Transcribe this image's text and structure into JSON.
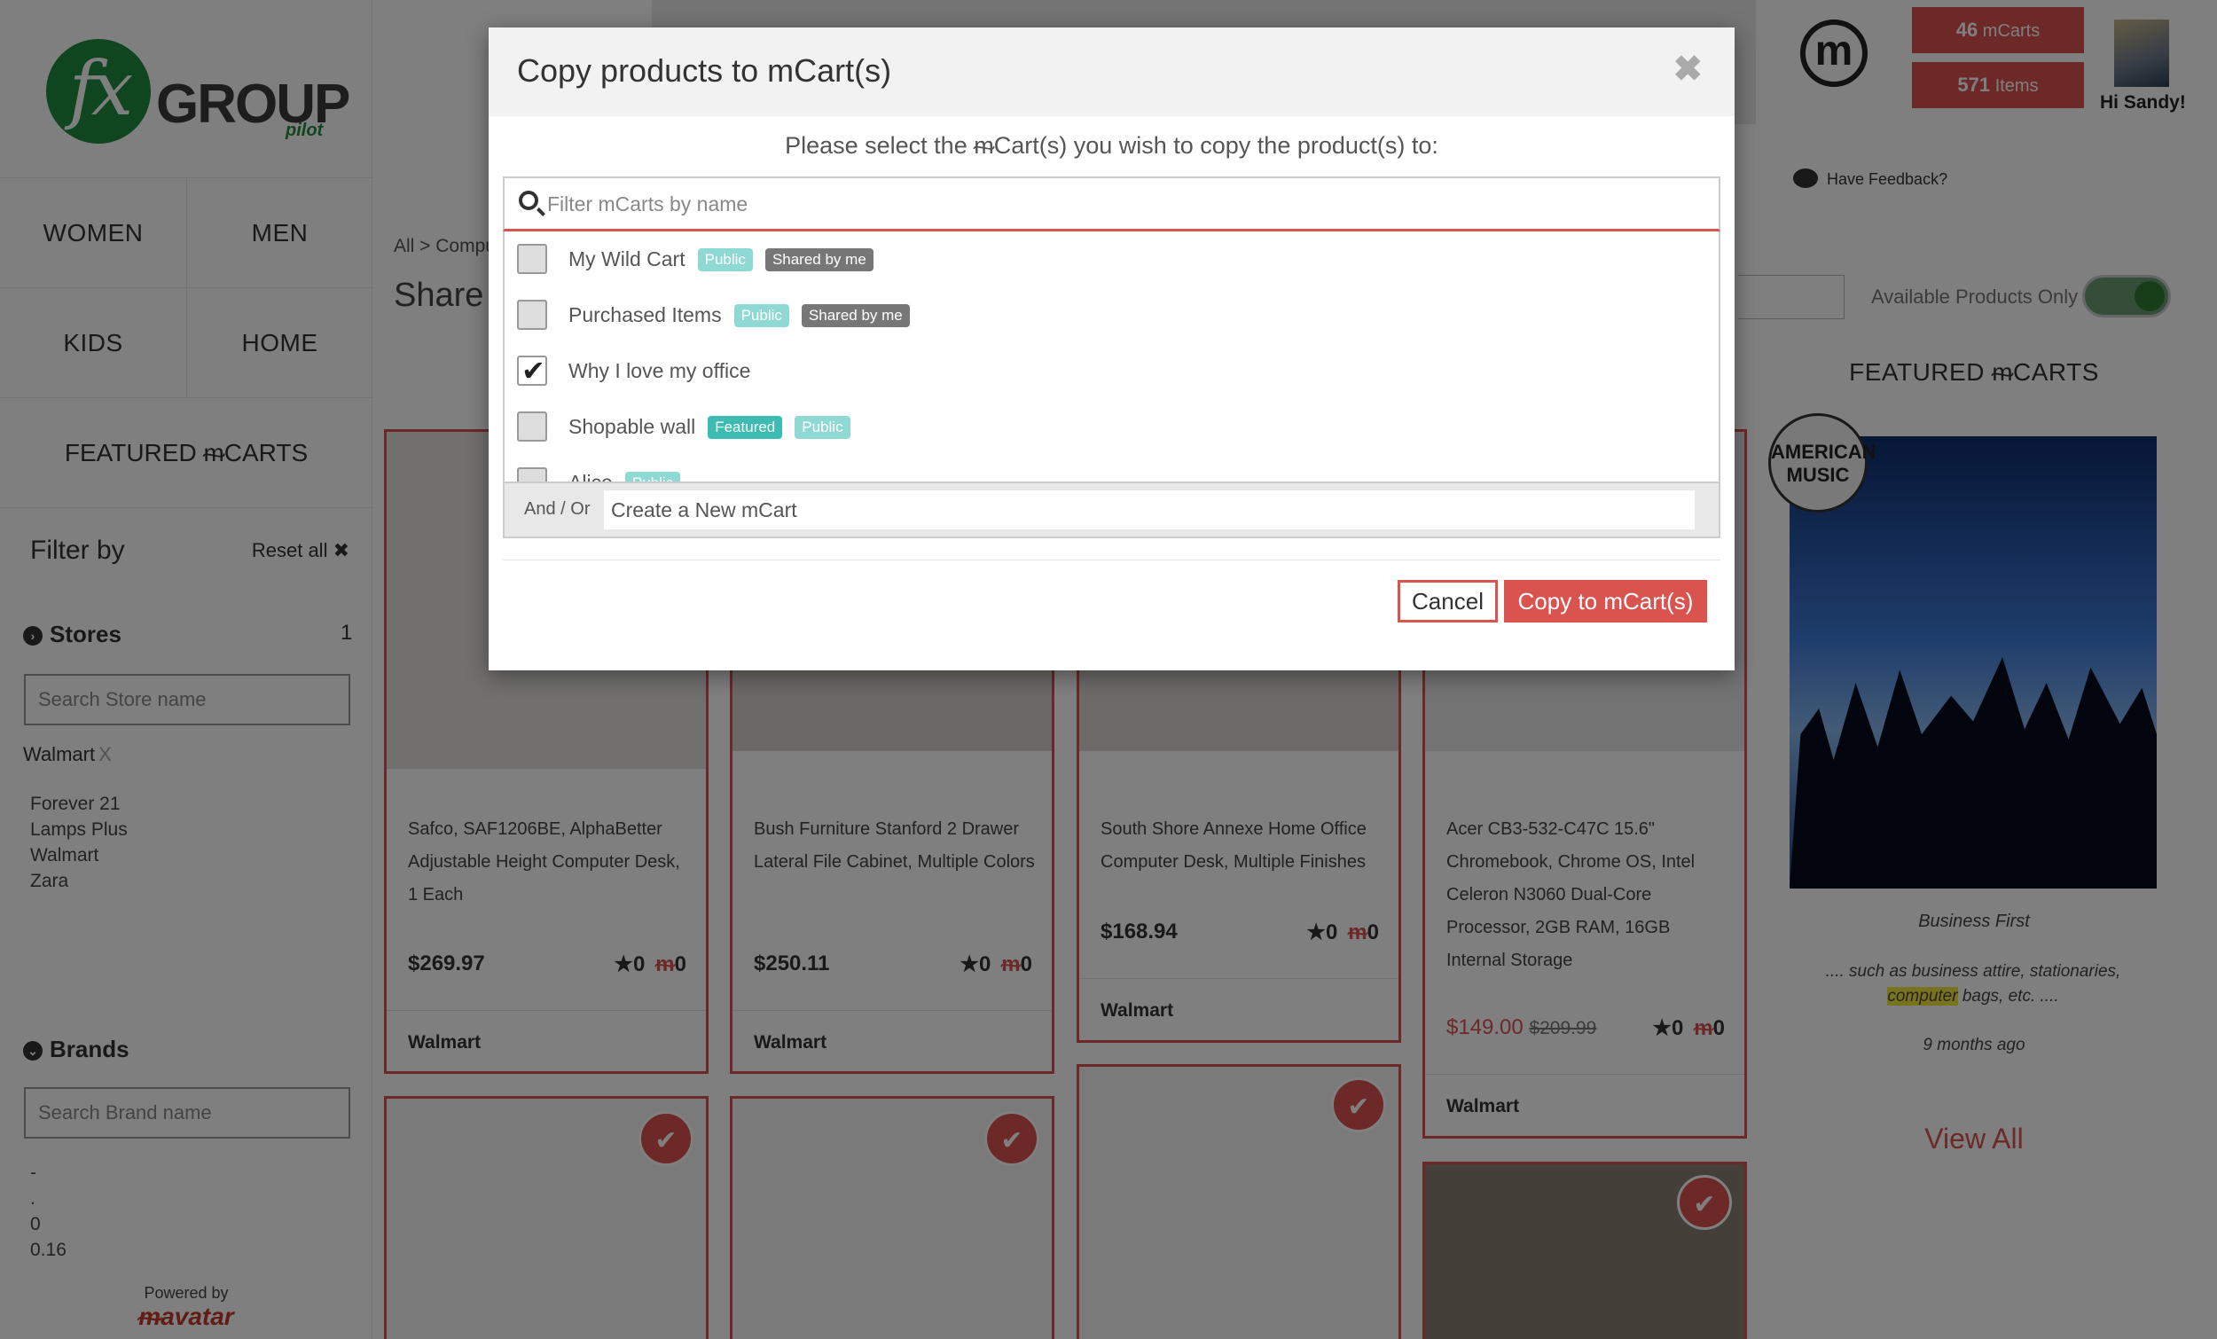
{
  "brand": {
    "logo_main": "fx",
    "logo_word": "GROUP",
    "logo_sub": "pilot"
  },
  "nav": {
    "women": "WOMEN",
    "men": "MEN",
    "kids": "KIDS",
    "home": "HOME",
    "featured": "FEATURED ᵯCARTS"
  },
  "filters": {
    "heading": "Filter by",
    "reset_label": "Reset all ✖",
    "stores_heading": "Stores",
    "stores_count": "1",
    "store_search_placeholder": "Search Store name",
    "store_selected": "Walmart",
    "store_selected_remove": "X",
    "store_options": [
      "Forever 21",
      "Lamps Plus",
      "Walmart",
      "Zara"
    ],
    "brands_heading": "Brands",
    "brand_search_placeholder": "Search Brand name",
    "brand_options": [
      "-",
      ".",
      "0",
      "0.16"
    ]
  },
  "powered_by": {
    "label": "Powered by",
    "brand": "ᵯavatar"
  },
  "header": {
    "mcarts_count": "46",
    "mcarts_label": "mCarts",
    "items_count": "571",
    "items_label": "Items",
    "greeting": "Hi Sandy!",
    "feedback": "Have Feedback?"
  },
  "main": {
    "breadcrumb": "All > Compu",
    "title": "Share",
    "available_only": "Available Products Only"
  },
  "products": [
    {
      "title": "Safco, SAF1206BE, AlphaBetter Adjustable Height Computer Desk, 1 Each",
      "price": "$269.97",
      "stars": "0",
      "mcarts": "0",
      "store": "Walmart"
    },
    {
      "title": "Bush Furniture Stanford 2 Drawer Lateral File Cabinet, Multiple Colors",
      "price": "$250.11",
      "stars": "0",
      "mcarts": "0",
      "store": "Walmart"
    },
    {
      "title": "South Shore Annexe Home Office Computer Desk, Multiple Finishes",
      "price": "$168.94",
      "stars": "0",
      "mcarts": "0",
      "store": "Walmart"
    },
    {
      "title": "Acer CB3-532-C47C 15.6\" Chromebook, Chrome OS, Intel Celeron N3060 Dual-Core Processor, 2GB RAM, 16GB Internal Storage",
      "price": "$149.00",
      "price_old": "$209.99",
      "stars": "0",
      "mcarts": "0",
      "store": "Walmart"
    }
  ],
  "featured": {
    "heading": "FEATURED ᵯCARTS",
    "badge": "AMERICAN MUSIC",
    "name": "Business First",
    "desc_before": ".... such as business attire, stationaries, ",
    "desc_highlight": "computer",
    "desc_after": " bags, etc. ....",
    "time": "9 months ago",
    "view_all": "View All"
  },
  "modal": {
    "title": "Copy products to mCart(s)",
    "close": "✖",
    "subtitle": "Please select the ᵯCart(s) you wish to copy the product(s) to:",
    "filter_placeholder": "Filter mCarts by name",
    "carts": [
      {
        "name": "My Wild Cart",
        "checked": false,
        "tags": [
          "Public",
          "Shared by me"
        ]
      },
      {
        "name": "Purchased Items",
        "checked": false,
        "tags": [
          "Public",
          "Shared by me"
        ]
      },
      {
        "name": "Why I love my office",
        "checked": true,
        "tags": []
      },
      {
        "name": "Shopable wall",
        "checked": false,
        "tags": [
          "Featured",
          "Public"
        ]
      },
      {
        "name": "Alice",
        "checked": false,
        "tags": [
          "Public"
        ]
      }
    ],
    "and_or": "And / Or",
    "new_cart_placeholder": "Create a New mCart",
    "cancel_label": "Cancel",
    "copy_label": "Copy to mCart(s)"
  }
}
